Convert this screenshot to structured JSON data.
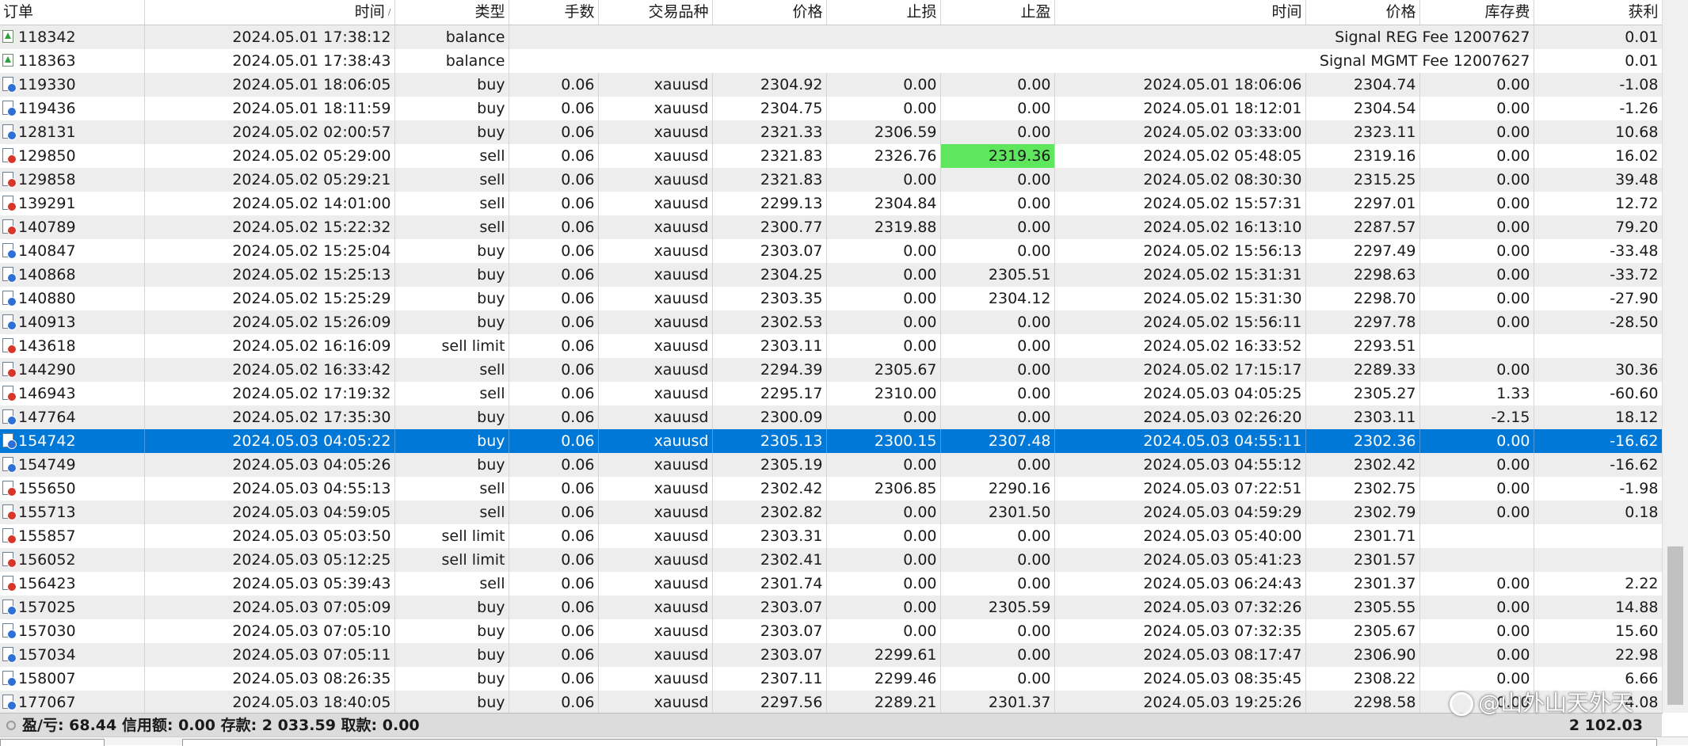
{
  "columns": [
    "订单",
    "时间",
    "类型",
    "手数",
    "交易品种",
    "价格",
    "止损",
    "止盈",
    "时间",
    "价格",
    "库存费",
    "获利"
  ],
  "sort_indicator": "/",
  "rows": [
    {
      "order": "118342",
      "kind": "balance",
      "open_time": "2024.05.01 17:38:12",
      "type": "balance",
      "comment": "Signal REG Fee 12007627",
      "profit": "0.01"
    },
    {
      "order": "118363",
      "kind": "balance",
      "open_time": "2024.05.01 17:38:43",
      "type": "balance",
      "comment": "Signal MGMT Fee 12007627",
      "profit": "0.01"
    },
    {
      "order": "119330",
      "kind": "buy",
      "open_time": "2024.05.01 18:06:05",
      "type": "buy",
      "volume": "0.06",
      "symbol": "xauusd",
      "price": "2304.92",
      "sl": "0.00",
      "tp": "0.00",
      "close_time": "2024.05.01 18:06:06",
      "close_price": "2304.74",
      "swap": "0.00",
      "profit": "-1.08"
    },
    {
      "order": "119436",
      "kind": "buy",
      "open_time": "2024.05.01 18:11:59",
      "type": "buy",
      "volume": "0.06",
      "symbol": "xauusd",
      "price": "2304.75",
      "sl": "0.00",
      "tp": "0.00",
      "close_time": "2024.05.01 18:12:01",
      "close_price": "2304.54",
      "swap": "0.00",
      "profit": "-1.26"
    },
    {
      "order": "128131",
      "kind": "buy",
      "open_time": "2024.05.02 02:00:57",
      "type": "buy",
      "volume": "0.06",
      "symbol": "xauusd",
      "price": "2321.33",
      "sl": "2306.59",
      "tp": "0.00",
      "close_time": "2024.05.02 03:33:00",
      "close_price": "2323.11",
      "swap": "0.00",
      "profit": "10.68"
    },
    {
      "order": "129850",
      "kind": "sell",
      "open_time": "2024.05.02 05:29:00",
      "type": "sell",
      "volume": "0.06",
      "symbol": "xauusd",
      "price": "2321.83",
      "sl": "2326.76",
      "tp": "2319.36",
      "tp_hit": true,
      "close_time": "2024.05.02 05:48:05",
      "close_price": "2319.16",
      "swap": "0.00",
      "profit": "16.02"
    },
    {
      "order": "129858",
      "kind": "sell",
      "open_time": "2024.05.02 05:29:21",
      "type": "sell",
      "volume": "0.06",
      "symbol": "xauusd",
      "price": "2321.83",
      "sl": "0.00",
      "tp": "0.00",
      "close_time": "2024.05.02 08:30:30",
      "close_price": "2315.25",
      "swap": "0.00",
      "profit": "39.48"
    },
    {
      "order": "139291",
      "kind": "sell",
      "open_time": "2024.05.02 14:01:00",
      "type": "sell",
      "volume": "0.06",
      "symbol": "xauusd",
      "price": "2299.13",
      "sl": "2304.84",
      "tp": "0.00",
      "close_time": "2024.05.02 15:57:31",
      "close_price": "2297.01",
      "swap": "0.00",
      "profit": "12.72"
    },
    {
      "order": "140789",
      "kind": "sell",
      "open_time": "2024.05.02 15:22:32",
      "type": "sell",
      "volume": "0.06",
      "symbol": "xauusd",
      "price": "2300.77",
      "sl": "2319.88",
      "tp": "0.00",
      "close_time": "2024.05.02 16:13:10",
      "close_price": "2287.57",
      "swap": "0.00",
      "profit": "79.20"
    },
    {
      "order": "140847",
      "kind": "buy",
      "open_time": "2024.05.02 15:25:04",
      "type": "buy",
      "volume": "0.06",
      "symbol": "xauusd",
      "price": "2303.07",
      "sl": "0.00",
      "tp": "0.00",
      "close_time": "2024.05.02 15:56:13",
      "close_price": "2297.49",
      "swap": "0.00",
      "profit": "-33.48"
    },
    {
      "order": "140868",
      "kind": "buy",
      "open_time": "2024.05.02 15:25:13",
      "type": "buy",
      "volume": "0.06",
      "symbol": "xauusd",
      "price": "2304.25",
      "sl": "0.00",
      "tp": "2305.51",
      "close_time": "2024.05.02 15:31:31",
      "close_price": "2298.63",
      "swap": "0.00",
      "profit": "-33.72"
    },
    {
      "order": "140880",
      "kind": "buy",
      "open_time": "2024.05.02 15:25:29",
      "type": "buy",
      "volume": "0.06",
      "symbol": "xauusd",
      "price": "2303.35",
      "sl": "0.00",
      "tp": "2304.12",
      "close_time": "2024.05.02 15:31:30",
      "close_price": "2298.70",
      "swap": "0.00",
      "profit": "-27.90"
    },
    {
      "order": "140913",
      "kind": "buy",
      "open_time": "2024.05.02 15:26:09",
      "type": "buy",
      "volume": "0.06",
      "symbol": "xauusd",
      "price": "2302.53",
      "sl": "0.00",
      "tp": "0.00",
      "close_time": "2024.05.02 15:56:11",
      "close_price": "2297.78",
      "swap": "0.00",
      "profit": "-28.50"
    },
    {
      "order": "143618",
      "kind": "sell",
      "open_time": "2024.05.02 16:16:09",
      "type": "sell limit",
      "volume": "0.06",
      "symbol": "xauusd",
      "price": "2303.11",
      "sl": "0.00",
      "tp": "0.00",
      "close_time": "2024.05.02 16:33:52",
      "close_price": "2293.51",
      "swap": "",
      "profit": ""
    },
    {
      "order": "144290",
      "kind": "sell",
      "open_time": "2024.05.02 16:33:42",
      "type": "sell",
      "volume": "0.06",
      "symbol": "xauusd",
      "price": "2294.39",
      "sl": "2305.67",
      "tp": "0.00",
      "close_time": "2024.05.02 17:15:17",
      "close_price": "2289.33",
      "swap": "0.00",
      "profit": "30.36"
    },
    {
      "order": "146943",
      "kind": "sell",
      "open_time": "2024.05.02 17:19:32",
      "type": "sell",
      "volume": "0.06",
      "symbol": "xauusd",
      "price": "2295.17",
      "sl": "2310.00",
      "tp": "0.00",
      "close_time": "2024.05.03 04:05:25",
      "close_price": "2305.27",
      "swap": "1.33",
      "profit": "-60.60"
    },
    {
      "order": "147764",
      "kind": "buy",
      "open_time": "2024.05.02 17:35:30",
      "type": "buy",
      "volume": "0.06",
      "symbol": "xauusd",
      "price": "2300.09",
      "sl": "0.00",
      "tp": "0.00",
      "close_time": "2024.05.03 02:26:20",
      "close_price": "2303.11",
      "swap": "-2.15",
      "profit": "18.12"
    },
    {
      "order": "154742",
      "kind": "buy",
      "selected": true,
      "open_time": "2024.05.03 04:05:22",
      "type": "buy",
      "volume": "0.06",
      "symbol": "xauusd",
      "price": "2305.13",
      "sl": "2300.15",
      "tp": "2307.48",
      "close_time": "2024.05.03 04:55:11",
      "close_price": "2302.36",
      "swap": "0.00",
      "profit": "-16.62"
    },
    {
      "order": "154749",
      "kind": "buy",
      "open_time": "2024.05.03 04:05:26",
      "type": "buy",
      "volume": "0.06",
      "symbol": "xauusd",
      "price": "2305.19",
      "sl": "0.00",
      "tp": "0.00",
      "close_time": "2024.05.03 04:55:12",
      "close_price": "2302.42",
      "swap": "0.00",
      "profit": "-16.62"
    },
    {
      "order": "155650",
      "kind": "sell",
      "open_time": "2024.05.03 04:55:13",
      "type": "sell",
      "volume": "0.06",
      "symbol": "xauusd",
      "price": "2302.42",
      "sl": "2306.85",
      "tp": "2290.16",
      "close_time": "2024.05.03 07:22:51",
      "close_price": "2302.75",
      "swap": "0.00",
      "profit": "-1.98"
    },
    {
      "order": "155713",
      "kind": "sell",
      "open_time": "2024.05.03 04:59:05",
      "type": "sell",
      "volume": "0.06",
      "symbol": "xauusd",
      "price": "2302.82",
      "sl": "0.00",
      "tp": "2301.50",
      "close_time": "2024.05.03 04:59:29",
      "close_price": "2302.79",
      "swap": "0.00",
      "profit": "0.18"
    },
    {
      "order": "155857",
      "kind": "sell",
      "open_time": "2024.05.03 05:03:50",
      "type": "sell limit",
      "volume": "0.06",
      "symbol": "xauusd",
      "price": "2303.31",
      "sl": "0.00",
      "tp": "0.00",
      "close_time": "2024.05.03 05:40:00",
      "close_price": "2301.71",
      "swap": "",
      "profit": ""
    },
    {
      "order": "156052",
      "kind": "sell",
      "open_time": "2024.05.03 05:12:25",
      "type": "sell limit",
      "volume": "0.06",
      "symbol": "xauusd",
      "price": "2302.41",
      "sl": "0.00",
      "tp": "0.00",
      "close_time": "2024.05.03 05:41:23",
      "close_price": "2301.57",
      "swap": "",
      "profit": ""
    },
    {
      "order": "156423",
      "kind": "sell",
      "open_time": "2024.05.03 05:39:43",
      "type": "sell",
      "volume": "0.06",
      "symbol": "xauusd",
      "price": "2301.74",
      "sl": "0.00",
      "tp": "0.00",
      "close_time": "2024.05.03 06:24:43",
      "close_price": "2301.37",
      "swap": "0.00",
      "profit": "2.22"
    },
    {
      "order": "157025",
      "kind": "buy",
      "open_time": "2024.05.03 07:05:09",
      "type": "buy",
      "volume": "0.06",
      "symbol": "xauusd",
      "price": "2303.07",
      "sl": "0.00",
      "tp": "2305.59",
      "close_time": "2024.05.03 07:32:26",
      "close_price": "2305.55",
      "swap": "0.00",
      "profit": "14.88"
    },
    {
      "order": "157030",
      "kind": "buy",
      "open_time": "2024.05.03 07:05:10",
      "type": "buy",
      "volume": "0.06",
      "symbol": "xauusd",
      "price": "2303.07",
      "sl": "0.00",
      "tp": "0.00",
      "close_time": "2024.05.03 07:32:35",
      "close_price": "2305.67",
      "swap": "0.00",
      "profit": "15.60"
    },
    {
      "order": "157034",
      "kind": "buy",
      "open_time": "2024.05.03 07:05:11",
      "type": "buy",
      "volume": "0.06",
      "symbol": "xauusd",
      "price": "2303.07",
      "sl": "2299.61",
      "tp": "0.00",
      "close_time": "2024.05.03 08:17:47",
      "close_price": "2306.90",
      "swap": "0.00",
      "profit": "22.98"
    },
    {
      "order": "158007",
      "kind": "buy",
      "open_time": "2024.05.03 08:26:35",
      "type": "buy",
      "volume": "0.06",
      "symbol": "xauusd",
      "price": "2307.11",
      "sl": "2299.46",
      "tp": "0.00",
      "close_time": "2024.05.03 08:35:45",
      "close_price": "2308.22",
      "swap": "0.00",
      "profit": "6.66"
    },
    {
      "order": "177067",
      "kind": "buy",
      "open_time": "2024.05.03 18:40:05",
      "type": "buy",
      "volume": "0.06",
      "symbol": "xauusd",
      "price": "2297.56",
      "sl": "2289.21",
      "tp": "2301.37",
      "close_time": "2024.05.03 19:25:26",
      "close_price": "2298.58",
      "swap": "0.00",
      "profit": "4.08"
    }
  ],
  "status": {
    "summary": "盈/亏: 68.44  信用额: 0.00  存款: 2 033.59  取款: 0.00",
    "total": "2 102.03"
  },
  "watermark": "@山外山天外天",
  "colors": {
    "selected_row": "#0078d7",
    "tp_hit": "#5ee65c",
    "buy_icon": "#2f6fd6",
    "sell_icon": "#d7372a",
    "balance_icon": "#2aa13a"
  }
}
